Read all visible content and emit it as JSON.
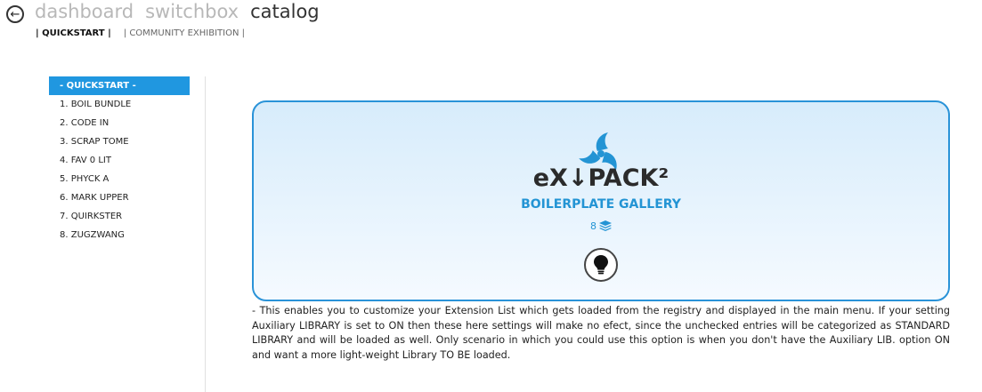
{
  "header": {
    "back_icon": "arrow-left-icon",
    "nav": [
      "dashboard",
      "switchbox",
      "catalog"
    ],
    "active_nav": "catalog"
  },
  "subnav": {
    "quickstart": "| QUICKSTART |",
    "community": "| COMMUNITY EXHIBITION |"
  },
  "sidebar": {
    "items": [
      {
        "label": "- QUICKSTART -",
        "active": true
      },
      {
        "label": "1. BOIL BUNDLE"
      },
      {
        "label": "2. CODE IN"
      },
      {
        "label": "3. SCRAP TOME"
      },
      {
        "label": "4. FAV 0 LIT"
      },
      {
        "label": "5. PHYCK A"
      },
      {
        "label": "6. MARK UPPER"
      },
      {
        "label": "7. QUIRKSTER"
      },
      {
        "label": "8. ZUGZWANG"
      }
    ]
  },
  "card": {
    "logo_text": "eX↓PACK²",
    "logo_icon": "triskelion-logo-icon",
    "title": "BOILERPLATE GALLERY",
    "count": "8",
    "count_icon": "layers-icon",
    "bulb_icon": "lightbulb-icon",
    "accent_color": "#2394d4",
    "border_color": "#2a93d8"
  },
  "description": "- This enables you to customize your Extension List which gets loaded from the registry and displayed in the main menu. If your setting Auxiliary LIBRARY is set to ON then these here settings will make no efect, since the unchecked entries will be categorized as STANDARD LIBRARY and will be loaded as well. Only scenario in which you could use this option is when you don't have the Auxiliary LIB. option ON and want a more light-weight Library TO BE loaded."
}
